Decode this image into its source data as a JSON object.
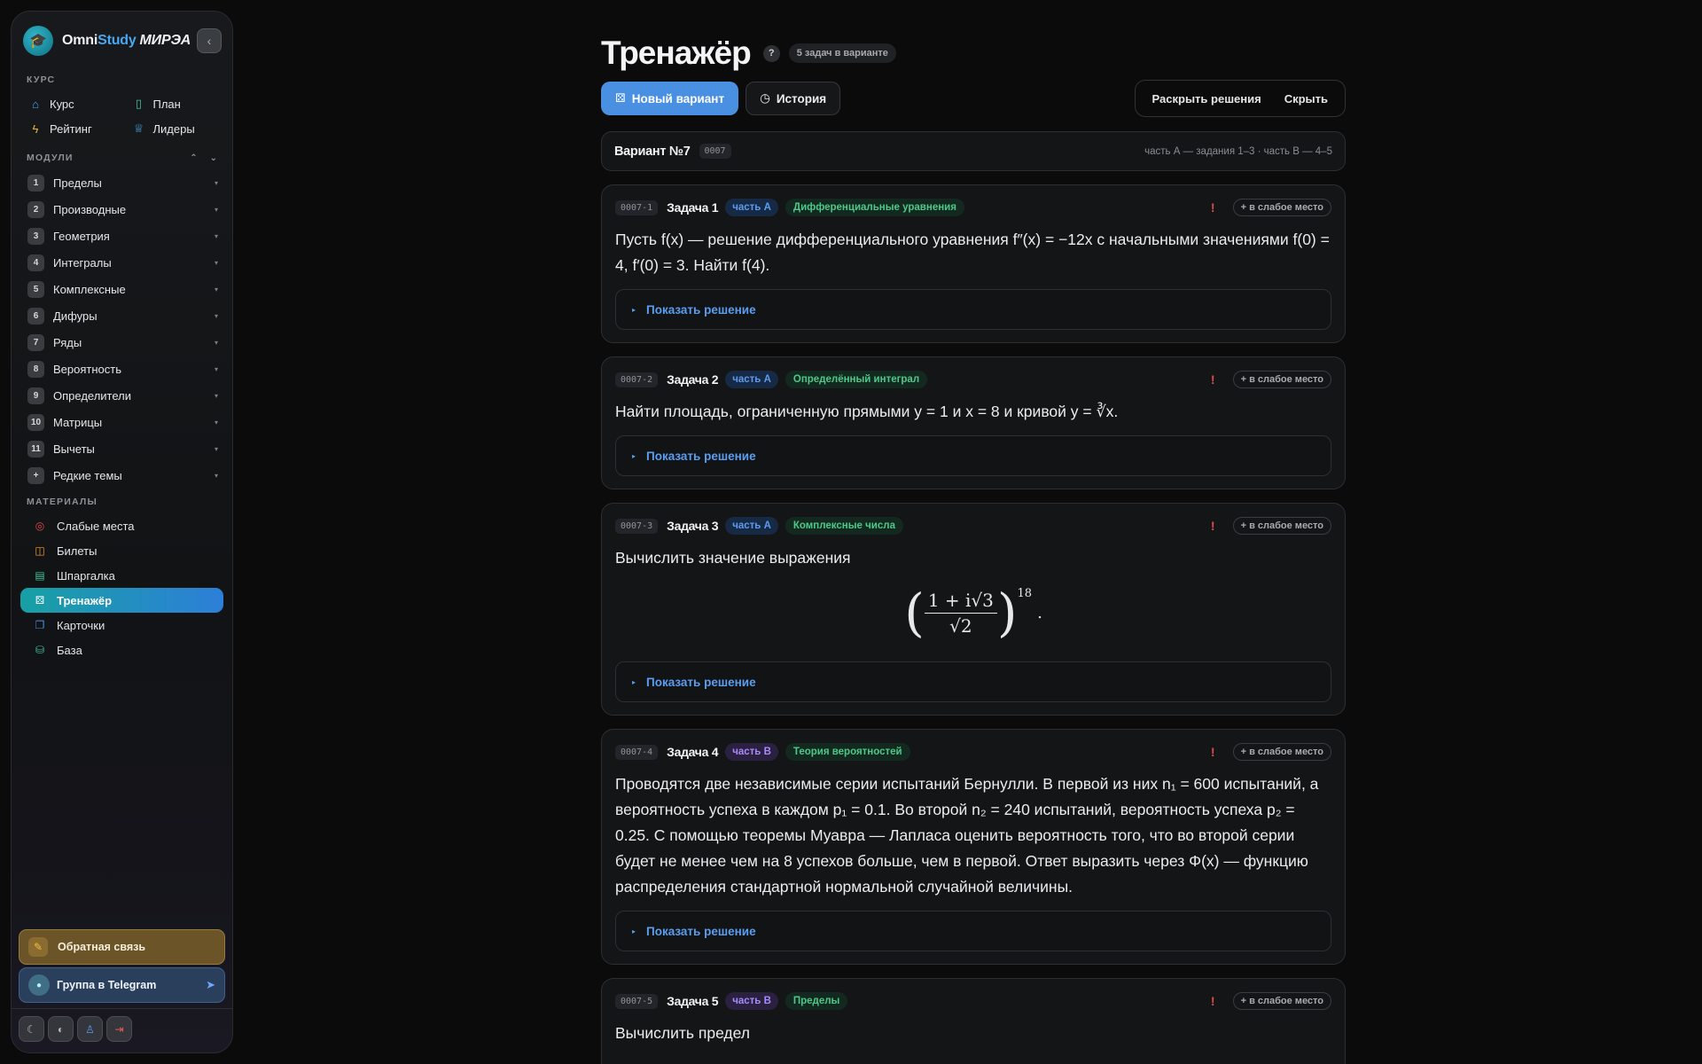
{
  "brand": {
    "omni": "Omni",
    "study": "Study",
    "mirea": "МИРЭА"
  },
  "sidebar": {
    "course_title": "КУРС",
    "course_items": [
      {
        "label": "Курс",
        "icon": "home-icon",
        "color": "#4aa8f0"
      },
      {
        "label": "План",
        "icon": "map-icon",
        "color": "#3fc49a"
      },
      {
        "label": "Рейтинг",
        "icon": "bolt-icon",
        "color": "#f0b429"
      },
      {
        "label": "Лидеры",
        "icon": "trophy-icon",
        "color": "#4aa8f0"
      }
    ],
    "modules_title": "МОДУЛИ",
    "modules": [
      {
        "num": "1",
        "label": "Пределы"
      },
      {
        "num": "2",
        "label": "Производные"
      },
      {
        "num": "3",
        "label": "Геометрия"
      },
      {
        "num": "4",
        "label": "Интегралы"
      },
      {
        "num": "5",
        "label": "Комплексные"
      },
      {
        "num": "6",
        "label": "Дифуры"
      },
      {
        "num": "7",
        "label": "Ряды"
      },
      {
        "num": "8",
        "label": "Вероятность"
      },
      {
        "num": "9",
        "label": "Определители"
      },
      {
        "num": "10",
        "label": "Матрицы"
      },
      {
        "num": "11",
        "label": "Вычеты"
      },
      {
        "num": "+",
        "label": "Редкие темы"
      }
    ],
    "materials_title": "МАТЕРИАЛЫ",
    "materials": [
      {
        "label": "Слабые места",
        "icon": "target-icon",
        "color": "#e5484d"
      },
      {
        "label": "Билеты",
        "icon": "book-icon",
        "color": "#f0a03a"
      },
      {
        "label": "Шпаргалка",
        "icon": "note-icon",
        "color": "#3fc49a"
      },
      {
        "label": "Тренажёр",
        "icon": "dice-icon",
        "color": "#ffffff",
        "active": true
      },
      {
        "label": "Карточки",
        "icon": "cards-icon",
        "color": "#4a90e2"
      },
      {
        "label": "База",
        "icon": "database-icon",
        "color": "#3fc49a"
      }
    ],
    "feedback_label": "Обратная связь",
    "telegram_label": "Группа в Telegram"
  },
  "page": {
    "title": "Тренажёр",
    "help": "?",
    "count_badge": "5 задач в варианте",
    "new_variant": "Новый вариант",
    "history": "История",
    "reveal": "Раскрыть решения",
    "hide": "Скрыть"
  },
  "variant": {
    "title": "Вариант №7",
    "code": "0007",
    "meta": "часть А — задания 1–3 · часть В — 4–5"
  },
  "common": {
    "show_solution": "Показать решение",
    "weak_spot": "+ в слабое место",
    "flag": "!"
  },
  "tasks": [
    {
      "code": "0007-1",
      "name": "Задача 1",
      "part": "часть А",
      "topic": "Дифференциальные уравнения",
      "text": "Пусть f(x) — решение дифференциального уравнения f″(x) = −12x с начальными значениями f(0) = 4, f′(0) = 3. Найти f(4)."
    },
    {
      "code": "0007-2",
      "name": "Задача 2",
      "part": "часть А",
      "topic": "Определённый интеграл",
      "text": "Найти площадь, ограниченную прямыми y = 1 и x = 8 и кривой y = ∛x."
    },
    {
      "code": "0007-3",
      "name": "Задача 3",
      "part": "часть А",
      "topic": "Комплексные числа",
      "text": "Вычислить значение выражения",
      "formula_num": "1 + i√3",
      "formula_den": "√2",
      "formula_exp": "18"
    },
    {
      "code": "0007-4",
      "name": "Задача 4",
      "part": "часть В",
      "topic": "Теория вероятностей",
      "text": "Проводятся две независимые серии испытаний Бернулли. В первой из них n₁ = 600 испытаний, а вероятность успеха в каждом p₁ = 0.1. Во второй n₂ = 240 испытаний, вероятность успеха p₂ = 0.25. С помощью теоремы Муавра — Лапласа оценить вероятность того, что во второй серии будет не менее чем на 8 успехов больше, чем в первой. Ответ выразить через Φ(x) — функцию распределения стандартной нормальной случайной величины."
    },
    {
      "code": "0007-5",
      "name": "Задача 5",
      "part": "часть В",
      "topic": "Пределы",
      "text": "Вычислить предел"
    }
  ]
}
